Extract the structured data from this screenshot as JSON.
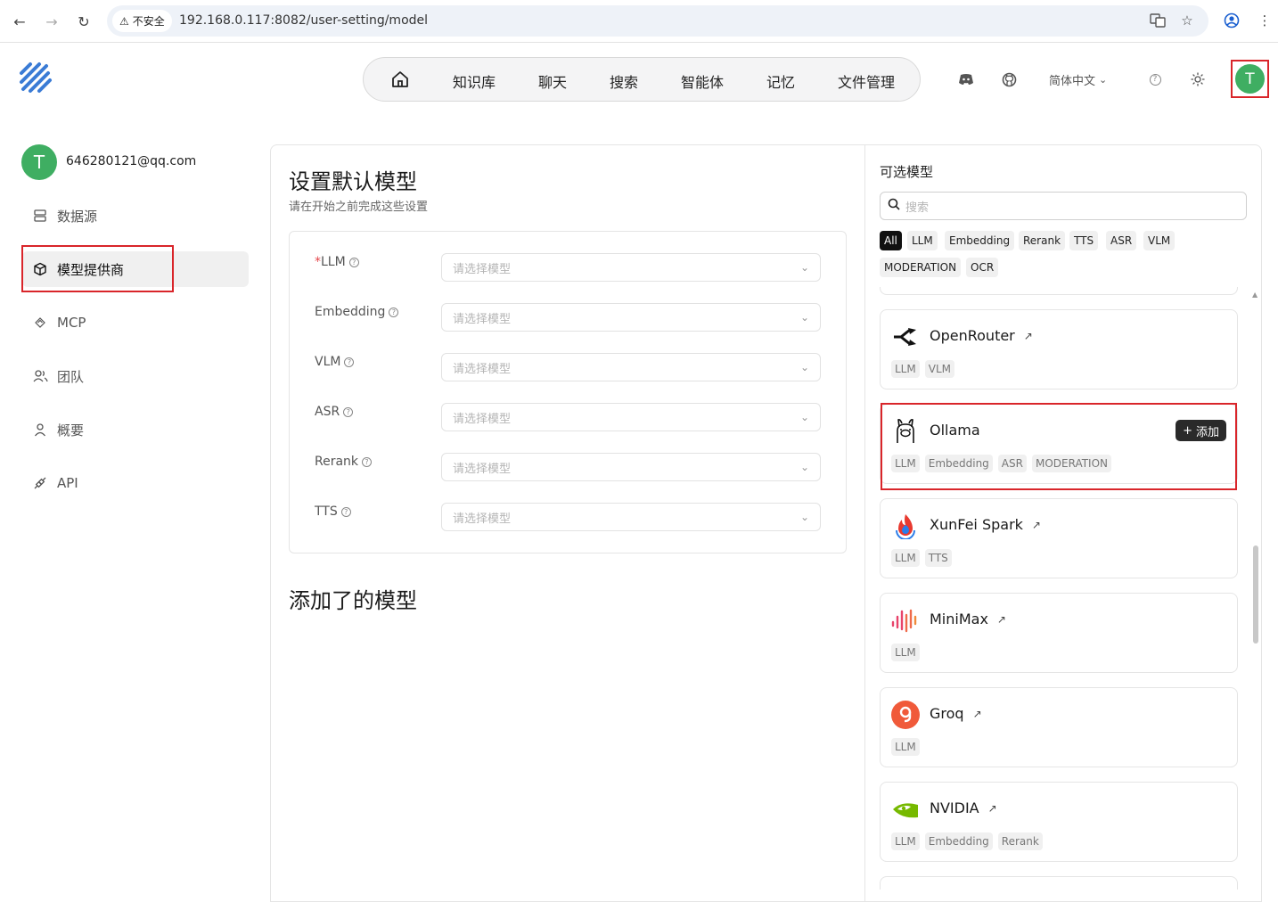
{
  "browser": {
    "insecure_label": "不安全",
    "url": "192.168.0.117:8082/user-setting/model"
  },
  "header": {
    "nav": [
      "知识库",
      "聊天",
      "搜索",
      "智能体",
      "记忆",
      "文件管理"
    ],
    "language": "简体中文",
    "avatar_letter": "T"
  },
  "sidebar": {
    "avatar_letter": "T",
    "email": "646280121@qq.com",
    "items": [
      {
        "label": "数据源",
        "icon": "database-icon"
      },
      {
        "label": "模型提供商",
        "icon": "cube-icon",
        "active": true
      },
      {
        "label": "MCP",
        "icon": "mcp-icon"
      },
      {
        "label": "团队",
        "icon": "team-icon"
      },
      {
        "label": "概要",
        "icon": "user-icon"
      },
      {
        "label": "API",
        "icon": "api-icon"
      }
    ]
  },
  "main": {
    "title": "设置默认模型",
    "subtitle": "请在开始之前完成这些设置",
    "placeholder": "请选择模型",
    "fields": [
      {
        "label": "LLM",
        "required": "*"
      },
      {
        "label": "Embedding",
        "required": ""
      },
      {
        "label": "VLM",
        "required": ""
      },
      {
        "label": "ASR",
        "required": ""
      },
      {
        "label": "Rerank",
        "required": ""
      },
      {
        "label": "TTS",
        "required": ""
      }
    ],
    "added_title": "添加了的模型"
  },
  "right": {
    "title": "可选模型",
    "search_placeholder": "搜索",
    "filters": [
      "All",
      "LLM",
      "Embedding",
      "Rerank",
      "TTS",
      "ASR",
      "VLM",
      "MODERATION",
      "OCR"
    ],
    "add_label": "添加",
    "providers": [
      {
        "name": "OpenRouter",
        "tags": [
          "LLM",
          "VLM"
        ]
      },
      {
        "name": "Ollama",
        "tags": [
          "LLM",
          "Embedding",
          "ASR",
          "MODERATION"
        ]
      },
      {
        "name": "XunFei Spark",
        "tags": [
          "LLM",
          "TTS"
        ]
      },
      {
        "name": "MiniMax",
        "tags": [
          "LLM"
        ]
      },
      {
        "name": "Groq",
        "tags": [
          "LLM"
        ]
      },
      {
        "name": "NVIDIA",
        "tags": [
          "LLM",
          "Embedding",
          "Rerank"
        ]
      }
    ]
  },
  "colors": {
    "accent_green": "#3fae62",
    "highlight_red": "#d9252a",
    "logo_blue": "#3a7bd5"
  }
}
